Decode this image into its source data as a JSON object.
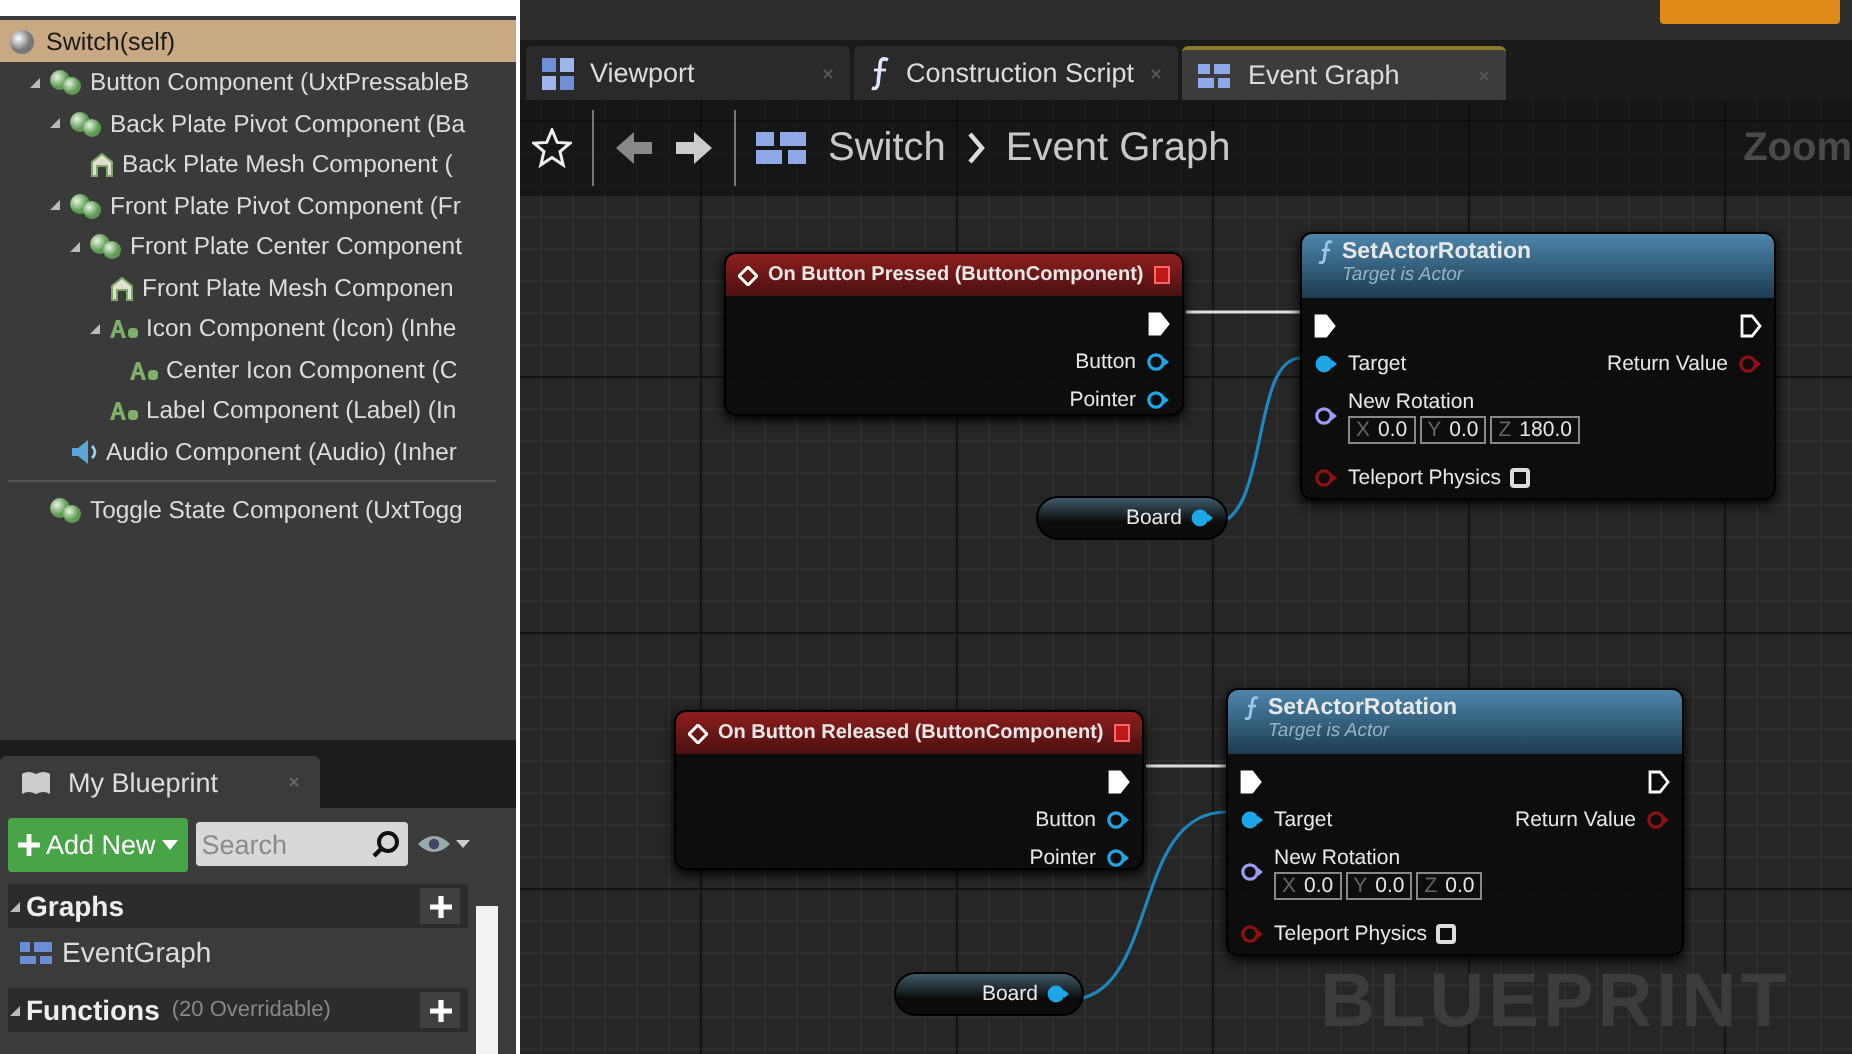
{
  "components": {
    "root": {
      "label": "Switch(self)",
      "selected": true
    },
    "items": [
      {
        "label": "Button Component (UxtPressableB",
        "kind": "scene",
        "expanded": true,
        "children": [
          {
            "label": "Back Plate Pivot Component (Ba",
            "kind": "scene",
            "expanded": true,
            "children": [
              {
                "label": "Back Plate Mesh Component (",
                "kind": "mesh"
              }
            ]
          },
          {
            "label": "Front Plate Pivot Component (Fr",
            "kind": "scene",
            "expanded": true,
            "children": [
              {
                "label": "Front Plate Center Component",
                "kind": "scene",
                "expanded": true,
                "children": [
                  {
                    "label": "Front Plate Mesh Componen",
                    "kind": "mesh"
                  },
                  {
                    "label": "Icon Component (Icon) (Inhe",
                    "kind": "text",
                    "expanded": true,
                    "children": [
                      {
                        "label": "Center Icon Component (C",
                        "kind": "text"
                      }
                    ]
                  },
                  {
                    "label": "Label Component (Label) (In",
                    "kind": "text"
                  }
                ]
              }
            ]
          },
          {
            "label": "Audio Component (Audio) (Inher",
            "kind": "audio"
          }
        ]
      }
    ],
    "other": [
      {
        "label": "Toggle State Component (UxtTogg",
        "kind": "scene"
      }
    ]
  },
  "my_blueprint": {
    "tab": "My Blueprint",
    "add_new": "Add New",
    "search": {
      "placeholder": "Search"
    },
    "categories": [
      {
        "label": "Graphs",
        "expanded": true,
        "items": [
          {
            "label": "EventGraph"
          }
        ]
      },
      {
        "label": "Functions",
        "note": "(20 Overridable)",
        "expanded": true
      }
    ]
  },
  "tabs": [
    {
      "label": "Viewport",
      "kind": "viewport",
      "selected": false
    },
    {
      "label": "Construction Script",
      "kind": "function",
      "selected": false
    },
    {
      "label": "Event Graph",
      "kind": "graph",
      "selected": true
    }
  ],
  "breadcrumb": {
    "items": [
      "Switch",
      "Event Graph"
    ],
    "zoom": "Zoom"
  },
  "graph": {
    "watermark": "BLUEPRINT",
    "nodes": [
      {
        "kind": "event",
        "title": "On Button Pressed (ButtonComponent)",
        "outputs": [
          {
            "kind": "object",
            "label": "Button",
            "connected": false
          },
          {
            "kind": "object",
            "label": "Pointer",
            "connected": false
          }
        ]
      },
      {
        "kind": "function",
        "title": "SetActorRotation",
        "subtitle": "Target is Actor",
        "inputs": [
          {
            "kind": "object",
            "label": "Target",
            "connected": true
          },
          {
            "kind": "rotator",
            "label": "New Rotation",
            "connected": false,
            "fields": [
              {
                "axis": "X",
                "value": "0.0"
              },
              {
                "axis": "Y",
                "value": "0.0"
              },
              {
                "axis": "Z",
                "value": "180.0"
              }
            ]
          },
          {
            "kind": "bool",
            "label": "Teleport Physics",
            "connected": false,
            "checked": false
          }
        ],
        "outputs": [
          {
            "kind": "bool",
            "label": "Return Value",
            "connected": false
          }
        ]
      },
      {
        "kind": "variable",
        "label": "Board",
        "connected": true
      },
      {
        "kind": "event",
        "title": "On Button Released (ButtonComponent)",
        "outputs": [
          {
            "kind": "object",
            "label": "Button",
            "connected": false
          },
          {
            "kind": "object",
            "label": "Pointer",
            "connected": false
          }
        ]
      },
      {
        "kind": "function",
        "title": "SetActorRotation",
        "subtitle": "Target is Actor",
        "inputs": [
          {
            "kind": "object",
            "label": "Target",
            "connected": true
          },
          {
            "kind": "rotator",
            "label": "New Rotation",
            "connected": false,
            "fields": [
              {
                "axis": "X",
                "value": "0.0"
              },
              {
                "axis": "Y",
                "value": "0.0"
              },
              {
                "axis": "Z",
                "value": "0.0"
              }
            ]
          },
          {
            "kind": "bool",
            "label": "Teleport Physics",
            "connected": false,
            "checked": false
          }
        ],
        "outputs": [
          {
            "kind": "bool",
            "label": "Return Value",
            "connected": false
          }
        ]
      },
      {
        "kind": "variable",
        "label": "Board",
        "connected": true
      }
    ]
  }
}
